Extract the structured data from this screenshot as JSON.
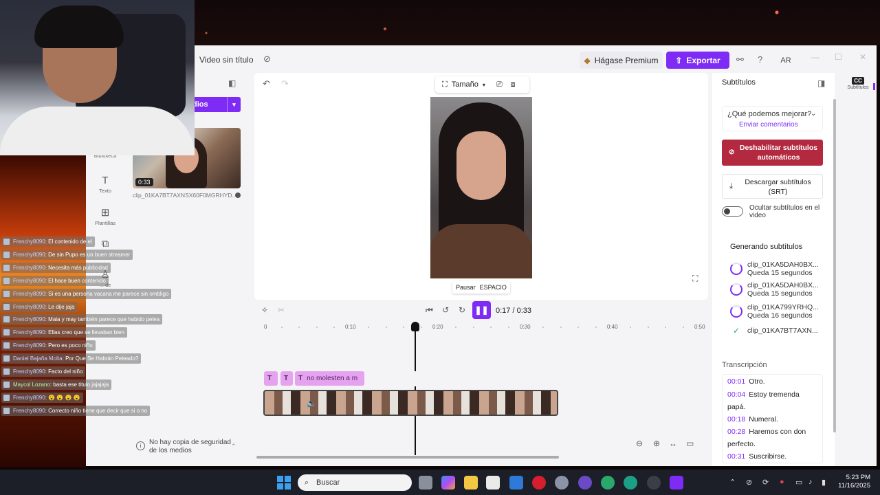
{
  "app": {
    "project_title": "Video sin título",
    "premium_label": "Hágase Premium",
    "export_label": "Exportar",
    "avatar_initials": "AR",
    "accent_color": "#7e2bf5"
  },
  "left_nav": {
    "items": [
      {
        "label": "Biblioteca",
        "icon": "library-icon"
      },
      {
        "label": "Texto",
        "icon": "text-icon"
      },
      {
        "label": "Plantillas",
        "icon": "templates-icon"
      },
      {
        "label": "",
        "icon": "transitions-icon"
      },
      {
        "label": "... de",
        "icon": "brand-icon"
      }
    ]
  },
  "media": {
    "button_label": "dios",
    "clip_duration": "0:33",
    "clip_name": "clip_01KA7BT7AXNSX60F0MGRHYD...",
    "backup_note": "No hay copia de seguridad de los medios"
  },
  "canvas": {
    "size_label": "Tamaño",
    "tooltip_action": "Pausar",
    "tooltip_key": "ESPACIO"
  },
  "playback": {
    "current_time": "0:17",
    "total_time": "0:33",
    "timecode": "0:17 / 0:33",
    "progress": 0.515
  },
  "timeline": {
    "ruler_labels": [
      "0",
      "0:10",
      "0:20",
      "0:30",
      "0:40",
      "0:50"
    ],
    "subtitle_chips": [
      "",
      "",
      "no molesten a m"
    ],
    "playhead_time": "0:17"
  },
  "subtitles_panel": {
    "title": "Subtítulos",
    "feedback_question": "¿Qué podemos mejorar?",
    "feedback_link": "Enviar comentarios",
    "disable_button": "Deshabilitar subtítulos automáticos",
    "download_button": "Descargar subtítulos (SRT)",
    "hide_toggle_label": "Ocultar subtítulos en el video",
    "generating_title": "Generando subtítulos",
    "generating_items": [
      {
        "name": "clip_01KA5DAH0BX...",
        "status": "Queda 15 segundos",
        "done": false
      },
      {
        "name": "clip_01KA5DAH0BX...",
        "status": "Queda 15 segundos",
        "done": false
      },
      {
        "name": "clip_01KA799YRHQ...",
        "status": "Queda 16 segundos",
        "done": false
      },
      {
        "name": "clip_01KA7BT7AXN...",
        "status": "",
        "done": true
      }
    ],
    "transcription_title": "Transcripción",
    "transcript": [
      {
        "time": "00:01",
        "text": "Otro."
      },
      {
        "time": "00:04",
        "text": "Estoy tremenda papá."
      },
      {
        "time": "00:18",
        "text": "Numeral."
      },
      {
        "time": "00:28",
        "text": "Haremos con don perfecto."
      },
      {
        "time": "00:31",
        "text": "Suscribirse."
      }
    ],
    "rail_tab_label": "Subtítulos",
    "rail_tab_badge": "CC"
  },
  "chat": [
    {
      "user": "Frenchy8090",
      "msg": "El contenido de el"
    },
    {
      "user": "Frenchy8090",
      "msg": "De sin Pupo es un buen streamer"
    },
    {
      "user": "Frenchy8090",
      "msg": "Necesita más publicidad"
    },
    {
      "user": "Frenchy8090",
      "msg": "El hace buen contenido"
    },
    {
      "user": "Frenchy8090",
      "msg": "Si es una persona vacana me parece sin ombligo"
    },
    {
      "user": "Frenchy8090",
      "msg": "Le dije jaja"
    },
    {
      "user": "Frenchy8090",
      "msg": "Mala y may también parece que habido pelea"
    },
    {
      "user": "Frenchy8090",
      "msg": "Ellas creo que se llevaban bien"
    },
    {
      "user": "Frenchy8090",
      "msg": "Pero es poco niño"
    },
    {
      "user": "Daniel Bajaña Molta",
      "msg": "Por Que Se Habrán Peleado?"
    },
    {
      "user": "Frenchy8090",
      "msg": "Facto del niño"
    },
    {
      "user": "Maycol Lozano",
      "msg": "basta ese titulo jajajaja"
    },
    {
      "user": "Frenchy8090",
      "msg": "😮 😮 😮 😮"
    },
    {
      "user": "Frenchy8090",
      "msg": "Correcto niño tiene que decir que si o no"
    }
  ],
  "taskbar": {
    "search_placeholder": "Buscar",
    "time": "5:23 PM",
    "date": "11/16/2025"
  }
}
